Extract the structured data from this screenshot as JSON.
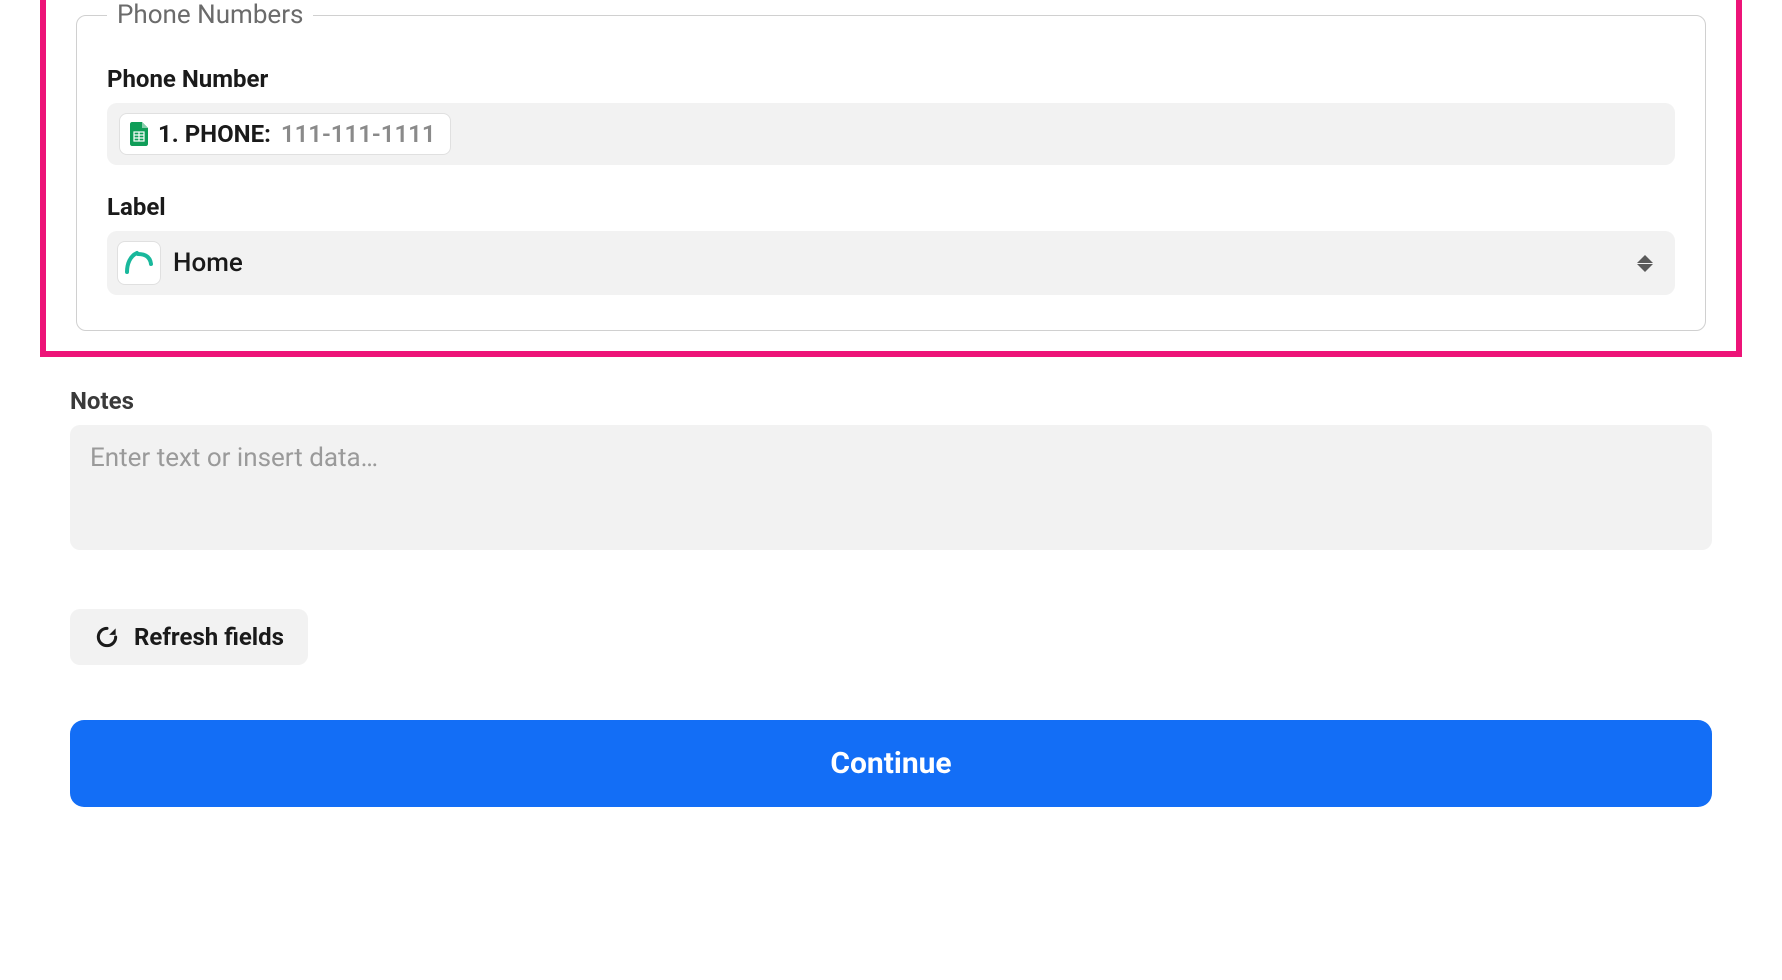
{
  "phone_section": {
    "legend": "Phone Numbers",
    "phone_number": {
      "label": "Phone Number",
      "pill_prefix": "1. PHONE:",
      "pill_value": "111-111-1111"
    },
    "label_field": {
      "label": "Label",
      "value": "Home"
    }
  },
  "notes": {
    "label": "Notes",
    "placeholder": "Enter text or insert data…"
  },
  "actions": {
    "refresh_label": "Refresh fields",
    "continue_label": "Continue"
  },
  "icons": {
    "sheets": "google-sheets-icon",
    "app": "app-logo-icon",
    "sort": "sort-updown-icon",
    "refresh": "refresh-icon"
  },
  "colors": {
    "highlight_border": "#ed1478",
    "primary_button": "#136ef6",
    "input_bg": "#f2f2f2"
  }
}
